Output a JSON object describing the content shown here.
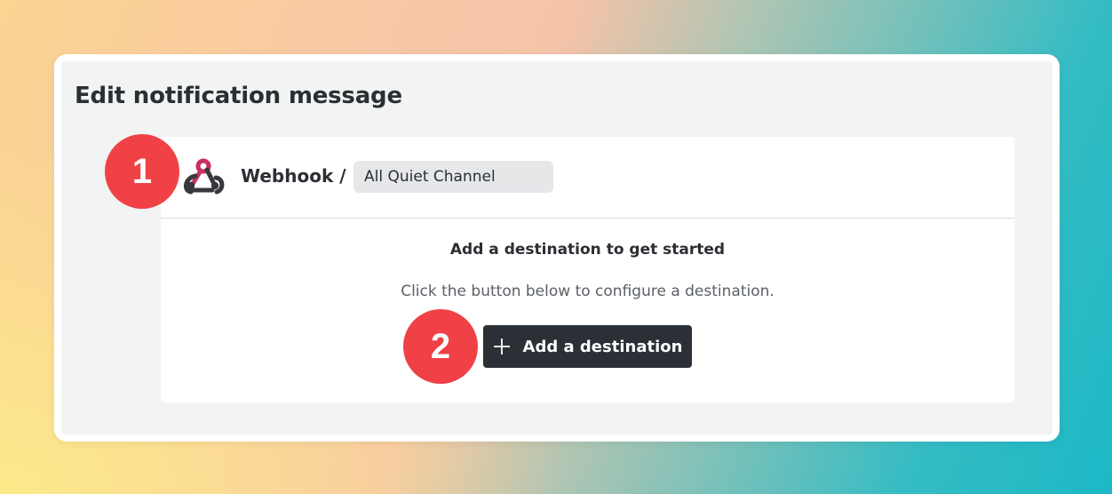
{
  "page_title": "Edit notification message",
  "destination": {
    "type_label": "Webhook /",
    "name": "All Quiet Channel",
    "icon": "webhook-icon"
  },
  "empty_state": {
    "title": "Add a destination to get started",
    "description": "Click the button below to configure a destination."
  },
  "add_button": {
    "label": "Add a destination",
    "icon": "plus-icon"
  },
  "callouts": [
    "1",
    "2"
  ],
  "colors": {
    "callout": "#ef4146",
    "button_bg": "#2a3035",
    "webhook_accent": "#c7305f",
    "webhook_dark": "#37393e",
    "panel_bg": "#f2f3f3"
  }
}
